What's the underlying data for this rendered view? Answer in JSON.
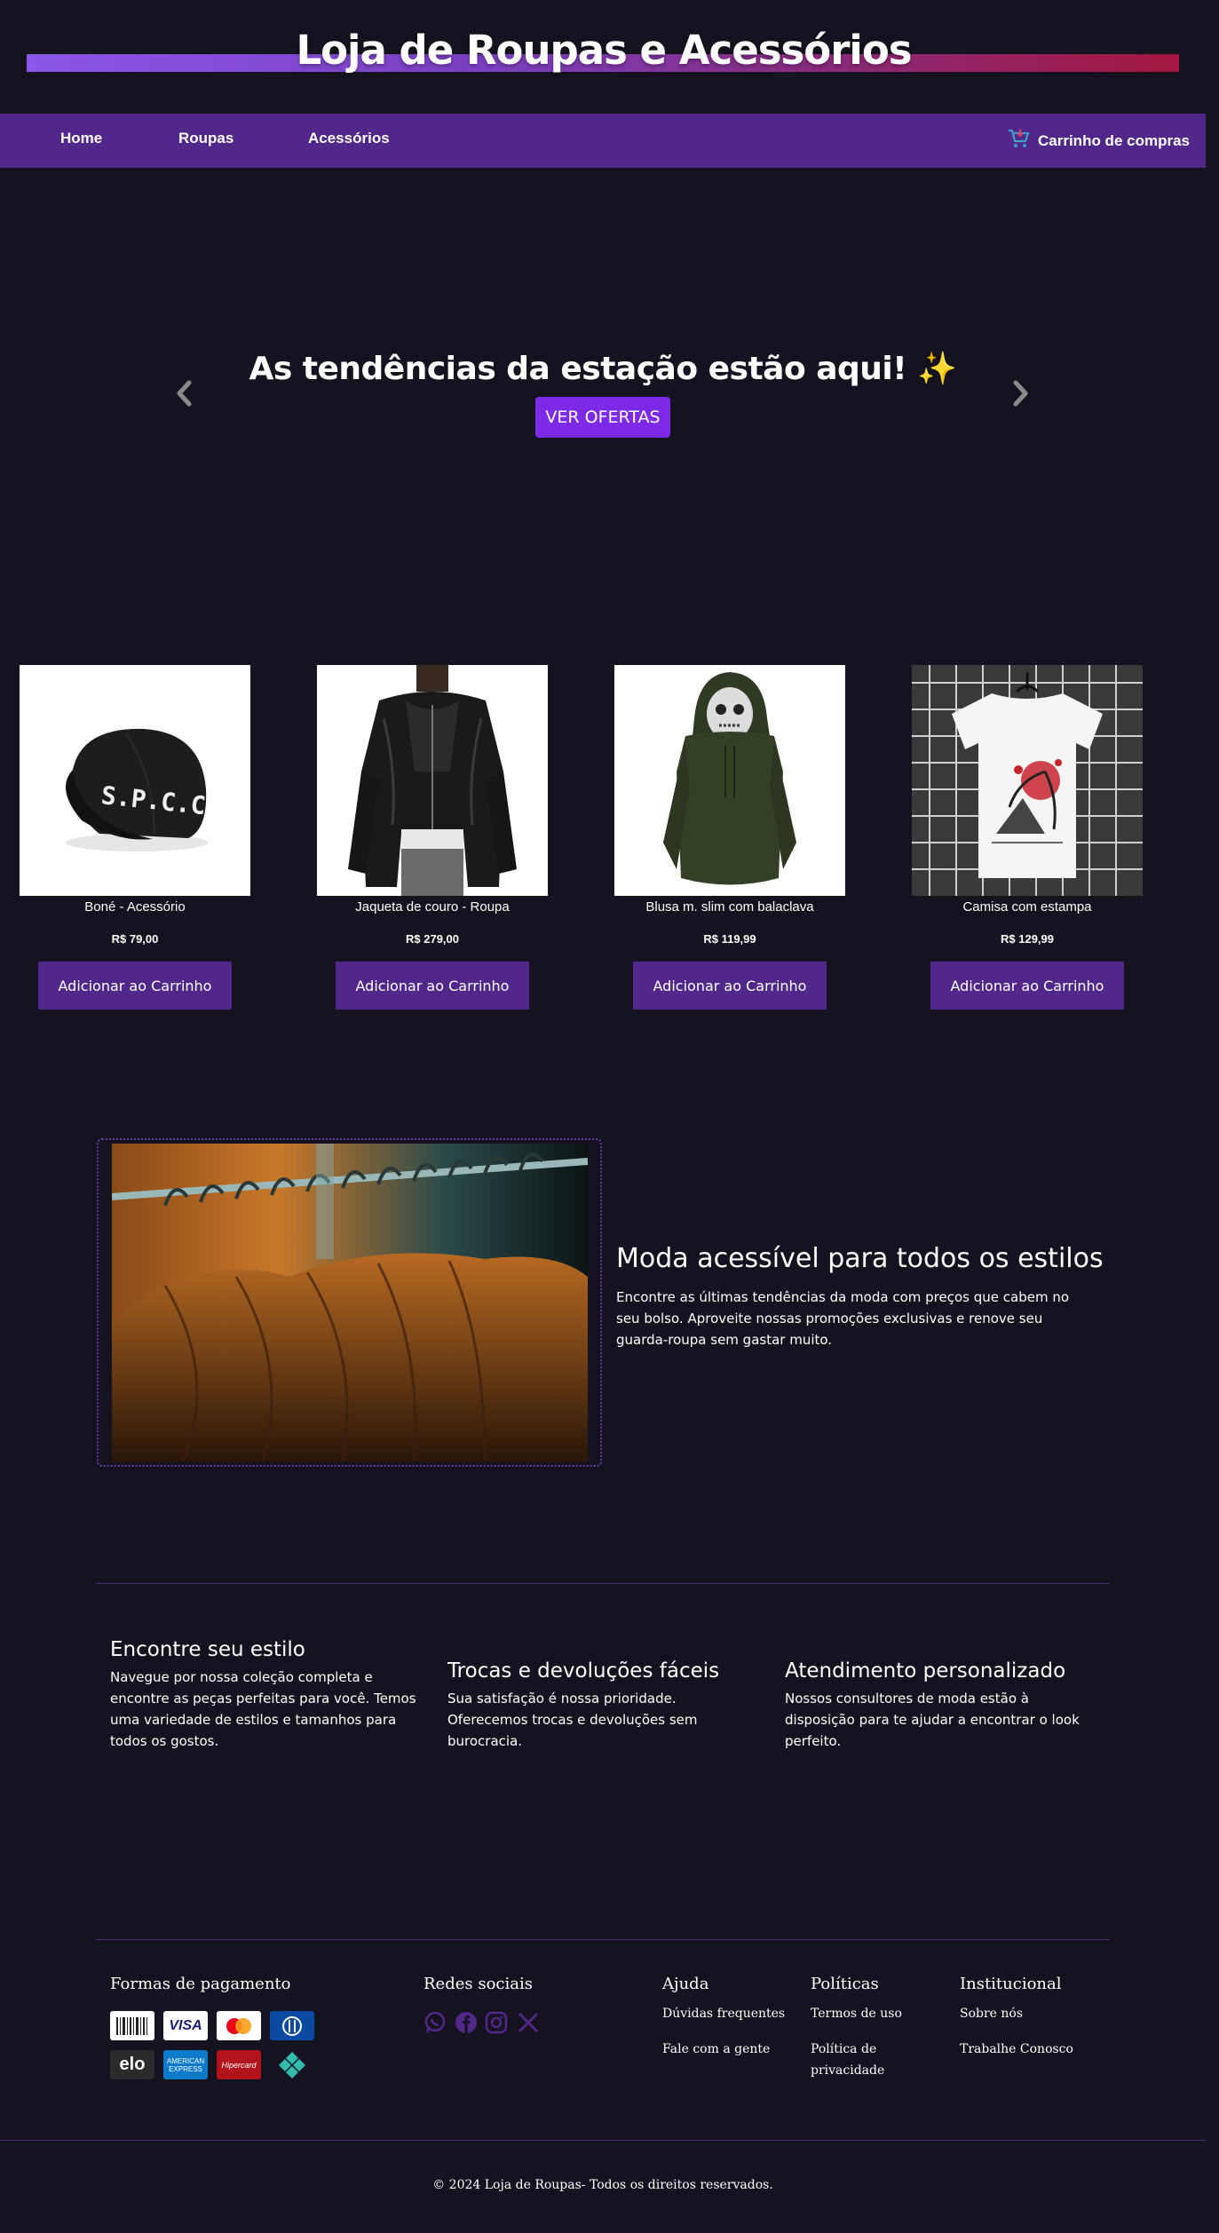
{
  "header": {
    "title": "Loja de Roupas e Acessórios"
  },
  "nav": {
    "links": [
      "Home",
      "Roupas",
      "Acessórios"
    ],
    "cart_label": "Carrinho de compras",
    "cart_icon": "cart-icon"
  },
  "hero": {
    "title": "As tendências da estação estão aqui! ✨",
    "button": "VER OFERTAS",
    "prev_icon": "chevron-left-icon",
    "next_icon": "chevron-right-icon"
  },
  "products": [
    {
      "name": "Boné - Acessório",
      "price": "R$ 79,00",
      "button": "Adicionar ao Carrinho",
      "image_text": "S.P.C.C"
    },
    {
      "name": "Jaqueta de couro - Roupa",
      "price": "R$ 279,00",
      "button": "Adicionar ao Carrinho"
    },
    {
      "name": "Blusa m. slim com balaclava",
      "price": "R$ 119,99",
      "button": "Adicionar ao Carrinho"
    },
    {
      "name": "Camisa com estampa",
      "price": "R$ 129,99",
      "button": "Adicionar ao Carrinho"
    }
  ],
  "feature": {
    "title": "Moda acessível para todos os estilos",
    "text": "Encontre as últimas tendências da moda com preços que cabem no seu bolso. Aproveite nossas promoções exclusivas e renove seu guarda-roupa sem gastar muito."
  },
  "info": [
    {
      "title": "Encontre seu estilo",
      "text": "Navegue por nossa coleção completa e encontre as peças perfeitas para você. Temos uma variedade de estilos e tamanhos para todos os gostos."
    },
    {
      "title": "Trocas e devoluções fáceis",
      "text": "Sua satisfação é nossa prioridade. Oferecemos trocas e devoluções sem burocracia."
    },
    {
      "title": "Atendimento personalizado",
      "text": "Nossos consultores de moda estão à disposição para te ajudar a encontrar o look perfeito."
    }
  ],
  "footer": {
    "payments_title": "Formas de pagamento",
    "payments": {
      "visa": "VISA",
      "elo": "elo",
      "amex": "AMERICAN EXPRESS",
      "hipercard": "Hipercard"
    },
    "payment_icons": [
      "boleto-icon",
      "visa-icon",
      "mastercard-icon",
      "diners-icon",
      "elo-icon",
      "amex-icon",
      "hipercard-icon",
      "pix-icon"
    ],
    "social_title": "Redes sociais",
    "social_icons": [
      "whatsapp-icon",
      "facebook-icon",
      "instagram-icon",
      "x-icon"
    ],
    "help_title": "Ajuda",
    "help_links": [
      "Dúvidas frequentes",
      "Fale com a gente"
    ],
    "policies_title": "Políticas",
    "policies_links": [
      "Termos de uso",
      "Política de privacidade"
    ],
    "institutional_title": "Institucional",
    "institutional_links": [
      "Sobre nós",
      "Trabalhe Conosco"
    ],
    "copyright": "© 2024 Loja de Roupas- Todos os direitos reservados."
  },
  "colors": {
    "background": "#14131f",
    "nav": "#52278a",
    "accent": "#7d2ae8",
    "button": "#52278a"
  }
}
